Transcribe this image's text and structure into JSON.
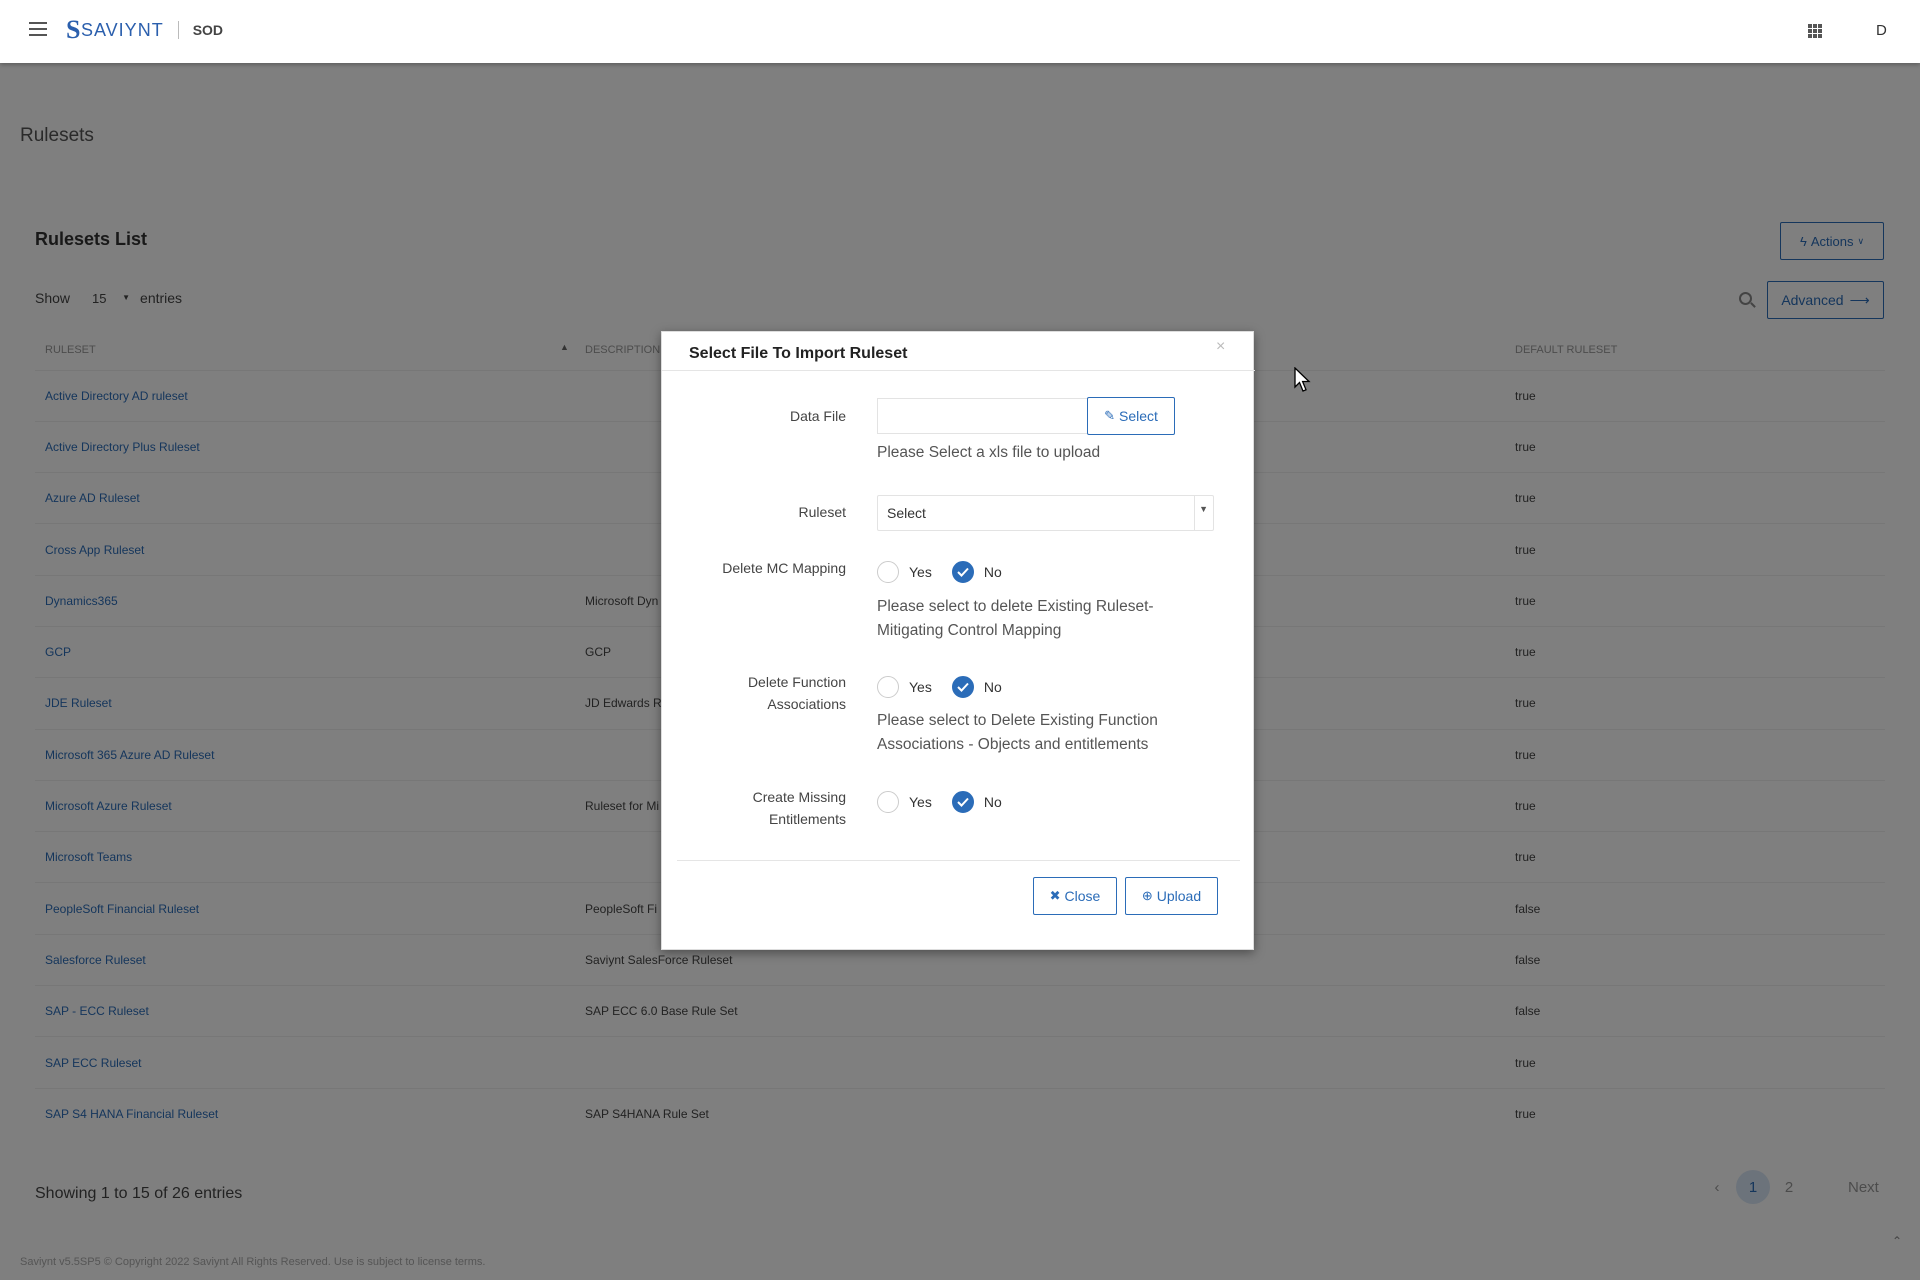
{
  "header": {
    "brand": "SAVIYNT",
    "app": "SOD",
    "user_initial": "D"
  },
  "page": {
    "title": "Rulesets",
    "list_title": "Rulesets List",
    "actions_label": "Actions",
    "show_label": "Show",
    "show_value": "15",
    "entries_label": "entries",
    "advanced_label": "Advanced"
  },
  "table": {
    "headers": [
      "RULESET",
      "DESCRIPTION",
      "DEFAULT RULESET"
    ],
    "rows": [
      [
        "Active Directory AD ruleset",
        "",
        "true"
      ],
      [
        "Active Directory Plus Ruleset",
        "",
        "true"
      ],
      [
        "Azure AD Ruleset",
        "",
        "true"
      ],
      [
        "Cross App Ruleset",
        "",
        "true"
      ],
      [
        "Dynamics365",
        "Microsoft Dyn",
        "true"
      ],
      [
        "GCP",
        "GCP",
        "true"
      ],
      [
        "JDE Ruleset",
        "JD Edwards R",
        "true"
      ],
      [
        "Microsoft 365 Azure AD Ruleset",
        "",
        "true"
      ],
      [
        "Microsoft Azure Ruleset",
        "Ruleset for Mi",
        "true"
      ],
      [
        "Microsoft Teams",
        "",
        "true"
      ],
      [
        "PeopleSoft Financial Ruleset",
        "PeopleSoft Fi",
        "false"
      ],
      [
        "Salesforce Ruleset",
        "Saviynt SalesForce Ruleset",
        "false"
      ],
      [
        "SAP - ECC Ruleset",
        "SAP ECC 6.0 Base Rule Set",
        "false"
      ],
      [
        "SAP ECC Ruleset",
        "",
        "true"
      ],
      [
        "SAP S4 HANA Financial Ruleset",
        "SAP S4HANA Rule Set",
        "true"
      ]
    ]
  },
  "pagination": {
    "showing": "Showing 1 to 15 of 26 entries",
    "page1": "1",
    "page2": "2",
    "next": "Next"
  },
  "footer": {
    "text": "Saviynt v5.5SP5 © Copyright 2022 Saviynt All Rights Reserved. Use is subject to license terms."
  },
  "modal": {
    "title": "Select File To Import Ruleset",
    "data_file_label": "Data File",
    "select_btn": "Select",
    "data_file_help": "Please Select a xls file to upload",
    "ruleset_label": "Ruleset",
    "ruleset_value": "Select",
    "delete_mc_label": "Delete MC Mapping",
    "delete_mc_help_1": "Please select to delete Existing Ruleset-",
    "delete_mc_help_2": "Mitigating Control Mapping",
    "delete_func_label_1": "Delete Function",
    "delete_func_label_2": "Associations",
    "delete_func_help_1": "Please select to Delete Existing Function",
    "delete_func_help_2": "Associations - Objects and entitlements",
    "create_missing_label_1": "Create Missing",
    "create_missing_label_2": "Entitlements",
    "yes": "Yes",
    "no": "No",
    "close_btn": "Close",
    "upload_btn": "Upload"
  },
  "colors": {
    "accent": "#2b6cb8",
    "overlay": "rgba(0,0,0,0.5)"
  }
}
